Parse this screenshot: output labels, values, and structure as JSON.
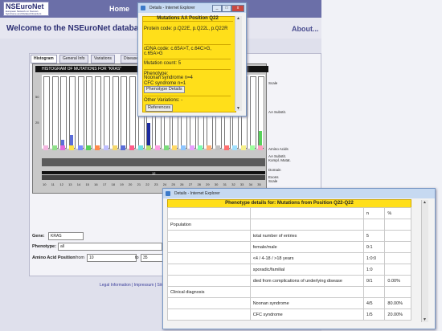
{
  "site": {
    "logo_name": "NSEuroNet",
    "logo_sub": "European Network on Noonan Syndrome and Related Disorders",
    "nav_home": "Home",
    "welcome": "Welcome to the NSEuroNet database",
    "about": "About..."
  },
  "tabs": [
    "Histogram",
    "General Info",
    "Variations",
    "Disease"
  ],
  "chart": {
    "title": "HISTOGRAM OF MUTATIONS FOR \"KRAS\"",
    "y_top_label": "50",
    "y_label_1": "25",
    "x_ticks": [
      "10",
      "11",
      "12",
      "13",
      "14",
      "15",
      "16",
      "17",
      "18",
      "19",
      "20",
      "21",
      "22",
      "23",
      "24",
      "25",
      "26",
      "27",
      "28",
      "29",
      "30",
      "31",
      "32",
      "33",
      "34",
      "35"
    ],
    "legend": [
      "Scale",
      "AA Substit.",
      "Amino Acids",
      "AA Substit. Kompl. Mutat.",
      "Domain",
      "Exons Scale"
    ],
    "domain_label": "12",
    "chart_data": {
      "type": "bar",
      "categories": [
        "10",
        "11",
        "12",
        "13",
        "14",
        "15",
        "16",
        "17",
        "18",
        "19",
        "20",
        "21",
        "22",
        "23",
        "24",
        "25",
        "26",
        "27",
        "28",
        "29",
        "30",
        "31",
        "32",
        "33",
        "34",
        "35"
      ],
      "values": [
        0,
        0,
        1,
        2,
        0,
        0,
        0,
        0,
        0,
        0,
        0,
        0,
        5,
        0,
        0,
        0,
        0,
        0,
        0,
        0,
        0,
        0,
        0,
        0,
        0,
        3
      ]
    }
  },
  "form": {
    "gene_label": "Gene:",
    "gene_value": "KRAS",
    "phenotype_label": "Phenotype:",
    "phenotype_value": "all",
    "aa_label": "Amino Acid Position",
    "from_label": "from",
    "from_value": "10",
    "to_label": "to",
    "to_value": "35"
  },
  "footer": "Legal Information | Impressum | Sitem",
  "win1": {
    "title": "Details - Internet Explorer",
    "header": "Mutations AA Position Q22",
    "protein": "Protein code: p.Q22E, p.Q22L, p.Q22R",
    "cdna": "cDNA code: c.65A>T, c.64C>G, c.65A>G",
    "count": "Mutation count: 5",
    "phenotype_label": "Phenotype:",
    "phenotype_1": "Noonan syndrome n=4",
    "phenotype_2": "CFC syndrome n=1",
    "details_button": "Phenotype Details",
    "other": "Other Variations: -",
    "references": "References"
  },
  "win2": {
    "title": "Details - Internet Explorer",
    "header": "Phenotype details for: Mutations from Position Q22-Q22",
    "cols": [
      "n",
      "%"
    ],
    "rows": [
      {
        "section": "Population",
        "label": "",
        "n": "",
        "pct": ""
      },
      {
        "section": "",
        "label": "total number of entries",
        "n": "5",
        "pct": ""
      },
      {
        "section": "",
        "label": "female/male",
        "n": "0:1",
        "pct": ""
      },
      {
        "section": "",
        "label": "<4 / 4-18 / >18 years",
        "n": "1:0:0",
        "pct": ""
      },
      {
        "section": "",
        "label": "sporadic/familial",
        "n": "1:0",
        "pct": ""
      },
      {
        "section": "",
        "label": "died from complications of underlying disease",
        "n": "0/1",
        "pct": "0.00%"
      },
      {
        "section": "Clinical diagnosis",
        "label": "",
        "n": "",
        "pct": ""
      },
      {
        "section": "",
        "label": "Noonan syndrome",
        "n": "4/5",
        "pct": "80.00%"
      },
      {
        "section": "",
        "label": "CFC syndrome",
        "n": "1/5",
        "pct": "20.00%"
      }
    ]
  }
}
